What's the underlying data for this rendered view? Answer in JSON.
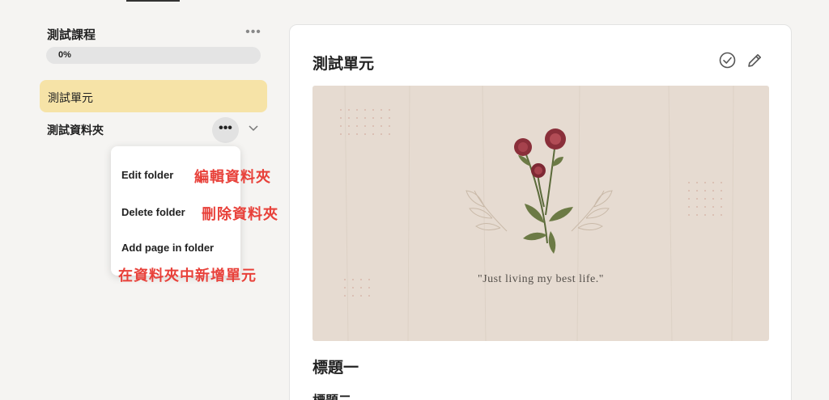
{
  "sidebar": {
    "course_title": "測試課程",
    "progress_label": "0%",
    "progress_value": 0,
    "unit_item_label": "測試單元",
    "folder_label": "測試資料夾",
    "more_glyph": "•••"
  },
  "context_menu": {
    "edit": "Edit folder",
    "delete": "Delete folder",
    "add_page": "Add page in folder"
  },
  "annotations": {
    "edit": "編輯資料夾",
    "delete": "刪除資料夾",
    "add_page": "在資料夾中新增單元"
  },
  "main": {
    "title": "測試單元",
    "hero_quote": "\"Just living my best life.\"",
    "heading1": "標題一",
    "heading2": "標題二"
  },
  "colors": {
    "active_item": "#f6e3a7",
    "annotation": "#e8413a",
    "hero_bg": "#e6dbd1"
  }
}
